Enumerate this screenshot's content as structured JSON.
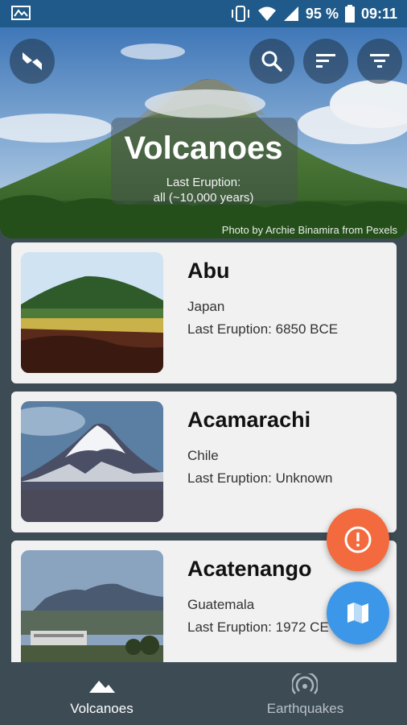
{
  "status_bar": {
    "battery_percent": "95 %",
    "time": "09:11",
    "icons": [
      "gallery-icon",
      "vibrate-icon",
      "wifi-icon",
      "signal-icon",
      "battery-icon"
    ]
  },
  "header": {
    "title": "Volcanoes",
    "subtitle_line1": "Last Eruption:",
    "subtitle_line2": "all (~10,000 years)",
    "photo_credit": "Photo by Archie Binamira from Pexels",
    "buttons": [
      "switch-icon",
      "search-icon",
      "sort-icon",
      "filter-icon"
    ]
  },
  "volcanoes": [
    {
      "name": "Abu",
      "country": "Japan",
      "last_eruption": "Last Eruption: 6850 BCE"
    },
    {
      "name": "Acamarachi",
      "country": "Chile",
      "last_eruption": "Last Eruption: Unknown"
    },
    {
      "name": "Acatenango",
      "country": "Guatemala",
      "last_eruption": "Last Eruption: 1972 CE"
    }
  ],
  "fabs": {
    "alert": "alert-icon",
    "map": "map-icon",
    "alert_color": "#f26a3d",
    "map_color": "#3d97e8"
  },
  "bottom_nav": {
    "items": [
      {
        "label": "Volcanoes",
        "icon": "mountain-icon",
        "active": true
      },
      {
        "label": "Earthquakes",
        "icon": "seismic-icon",
        "active": false
      }
    ]
  },
  "colors": {
    "status_bar": "#1f5a8a",
    "background": "#3d4b55",
    "card": "#f1f1f1"
  }
}
